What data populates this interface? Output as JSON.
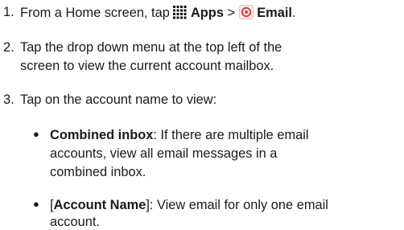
{
  "steps": [
    {
      "number": "1.",
      "prefix": "From a Home screen, tap",
      "apps_label": "Apps",
      "separator": ">",
      "email_label": "Email",
      "period": ".",
      "apps_icon": "apps-grid-icon",
      "email_icon": "email-app-icon"
    },
    {
      "number": "2.",
      "line1": "Tap the drop down menu at the top left of the",
      "line2": "screen to view the current account mailbox."
    },
    {
      "number": "3.",
      "line1": "Tap on the account name to view:"
    }
  ],
  "bullets": [
    {
      "term": "Combined inbox",
      "line1_rest": ": If there are multiple email",
      "line2": "accounts, view all email messages in a",
      "line3": "combined inbox."
    },
    {
      "bracket_open": "[",
      "term": "Account Name",
      "bracket_close": "]",
      "line1_rest": ": View email for only one email",
      "line2": "account."
    }
  ],
  "colors": {
    "text": "#1a1a1a",
    "email_icon_red": "#e0403a"
  }
}
